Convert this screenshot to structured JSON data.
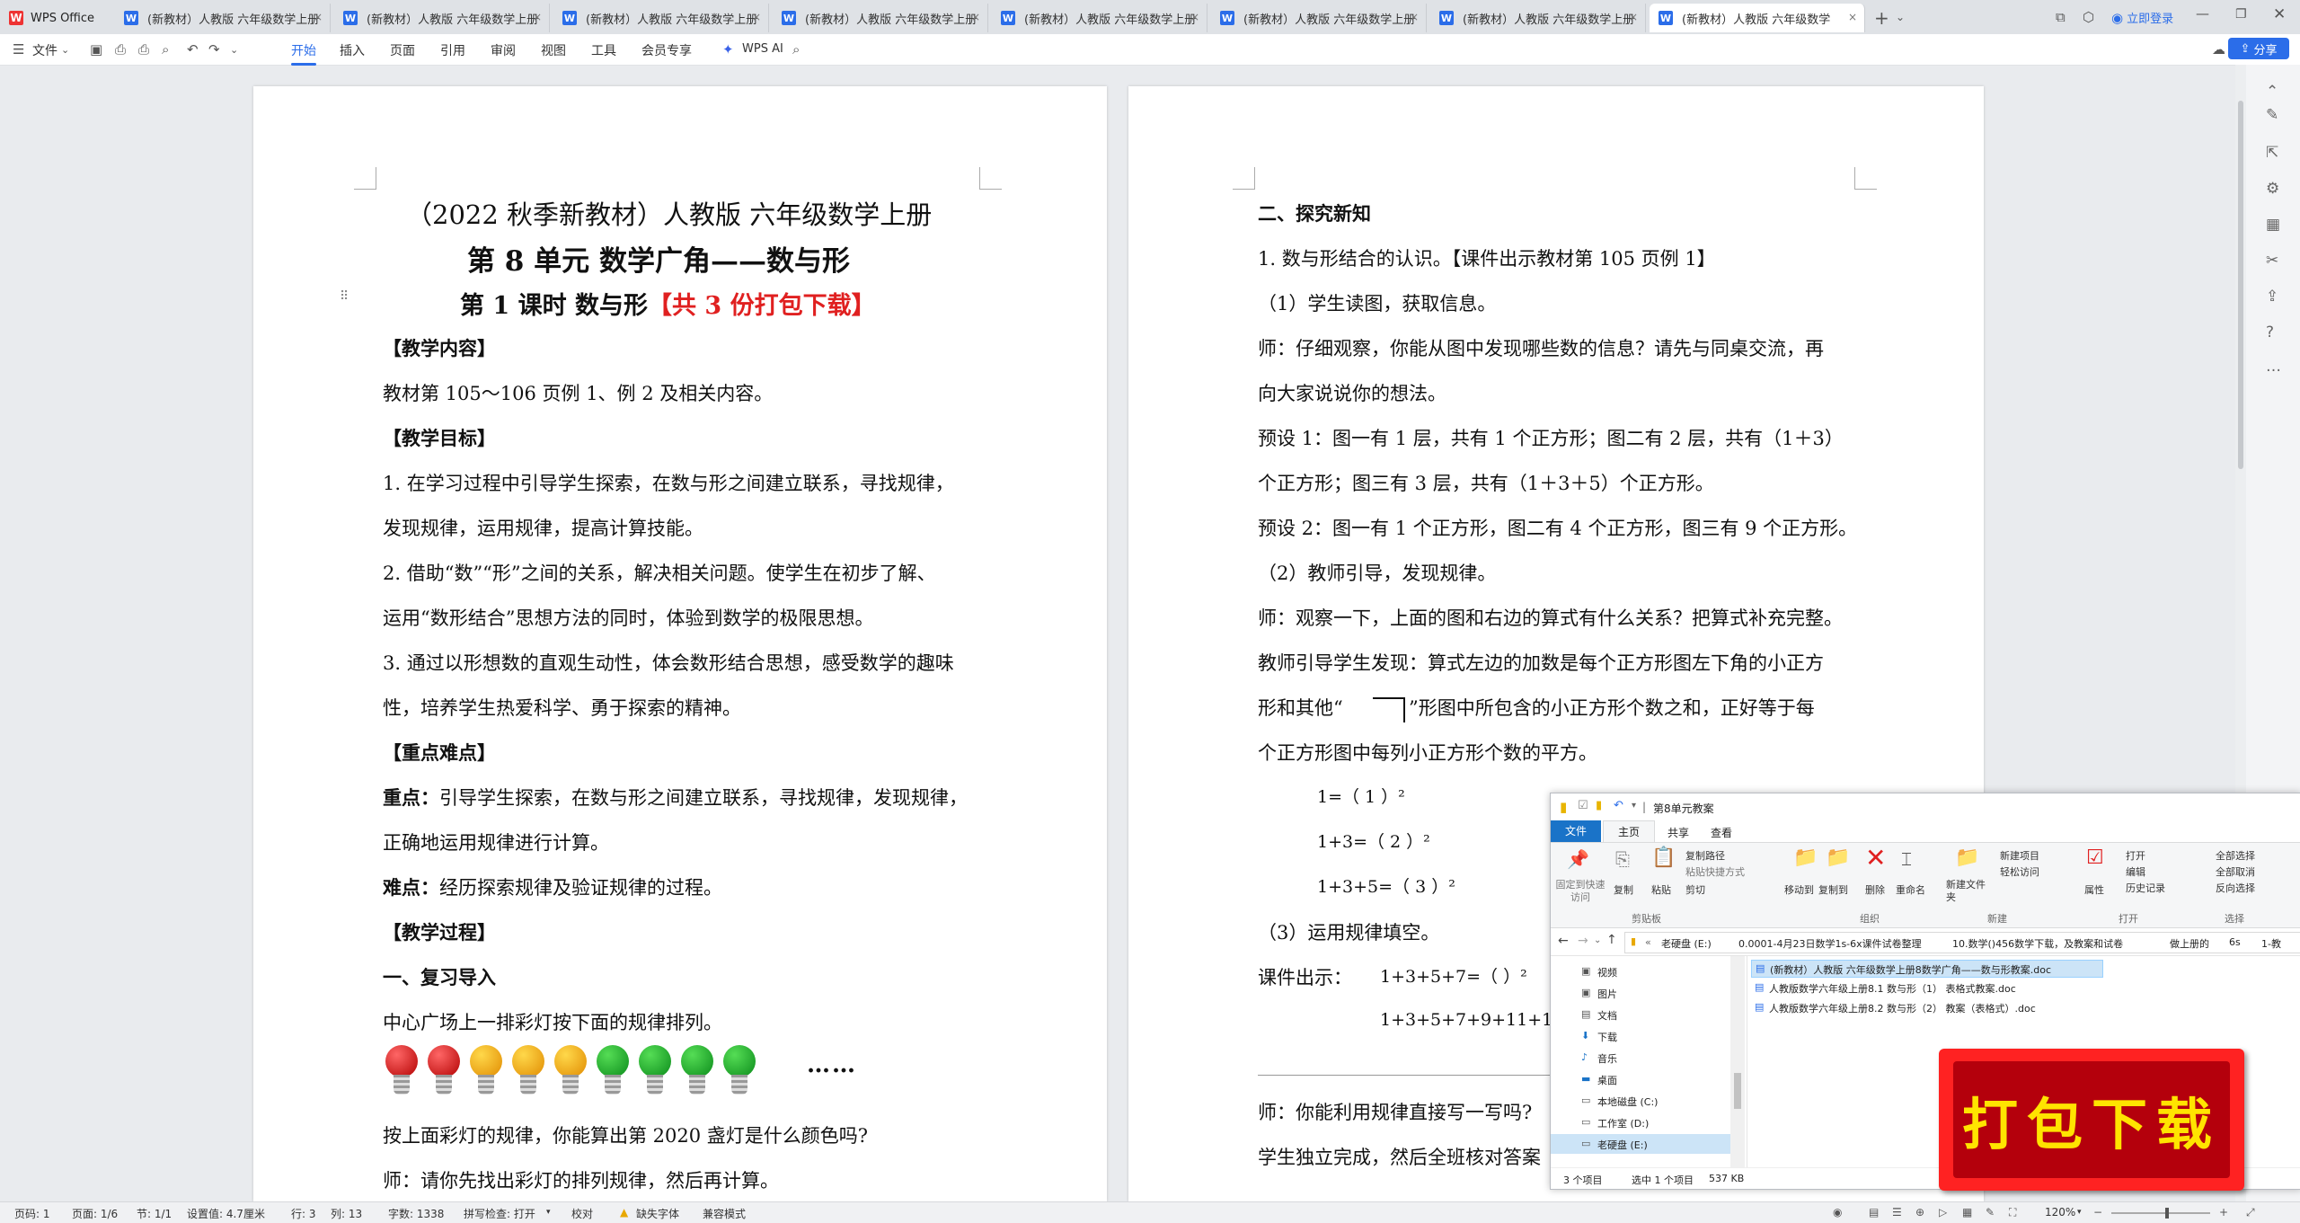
{
  "app": {
    "name": "WPS Office"
  },
  "tabs": [
    {
      "label": "(新教材）人教版 六年级数学上册"
    },
    {
      "label": "(新教材）人教版 六年级数学上册"
    },
    {
      "label": "(新教材）人教版 六年级数学上册"
    },
    {
      "label": "(新教材）人教版 六年级数学上册"
    },
    {
      "label": "(新教材）人教版 六年级数学上册"
    },
    {
      "label": "(新教材）人教版 六年级数学上册"
    },
    {
      "label": "(新教材）人教版 六年级数学上册"
    },
    {
      "label": "(新教材）人教版 六年级数学"
    }
  ],
  "titlebar": {
    "login": "立即登录",
    "share": "分享"
  },
  "toolbar": {
    "file": "文件",
    "menus": [
      "开始",
      "插入",
      "页面",
      "引用",
      "审阅",
      "视图",
      "工具",
      "会员专享"
    ],
    "wps_ai": "WPS AI"
  },
  "page1": {
    "title1": "（2022 秋季新教材）人教版  六年级数学上册",
    "title2": "第 8 单元  数学广角——数与形",
    "title3a": "第 1 课时    数与形",
    "title3b": "【共 3 份打包下载】",
    "lines": [
      "【教学内容】",
      "教材第 105～106 页例 1、例 2 及相关内容。",
      "【教学目标】",
      "1. 在学习过程中引导学生探索，在数与形之间建立联系，寻找规律，",
      "发现规律，运用规律，提高计算技能。",
      "2. 借助“数”“形”之间的关系，解决相关问题。使学生在初步了解、",
      "运用“数形结合”思想方法的同时，体验到数学的极限思想。",
      "3. 通过以形想数的直观生动性，体会数形结合思想，感受数学的趣味",
      "性，培养学生热爱科学、勇于探索的精神。",
      "【重点难点】",
      "正确地运用规律进行计算。",
      "【教学过程】",
      "一、复习导入",
      "中心广场上一排彩灯按下面的规律排列。",
      "按上面彩灯的规律，你能算出第 2020 盏灯是什么颜色吗?",
      "师：请你先找出彩灯的排列规律，然后再计算。"
    ],
    "zhongdian_label": "重点：",
    "zhongdian_text": "引导学生探索，在数与形之间建立联系，寻找规律，发现规律，",
    "nandian_label": "难点：",
    "nandian_text": "经历探索规律及验证规律的过程。",
    "dots": "……"
  },
  "page2": {
    "lines": [
      "二、探究新知",
      "1. 数与形结合的认识。【课件出示教材第 105 页例 1】",
      "（1）学生读图，获取信息。",
      "师：仔细观察，你能从图中发现哪些数的信息？请先与同桌交流，再",
      "向大家说说你的想法。",
      "预设 1：图一有 1 层，共有 1 个正方形；图二有 2 层，共有（1＋3）",
      "个正方形；图三有 3 层，共有（1＋3＋5）个正方形。",
      "预设 2：图一有 1 个正方形，图二有 4 个正方形，图三有 9 个正方形。",
      "（2）教师引导，发现规律。",
      "师：观察一下，上面的图和右边的算式有什么关系？把算式补充完整。",
      "教师引导学生发现：算式左边的加数是每个正方形图左下角的小正方",
      "形和其他“",
      "”形图中所包含的小正方形个数之和，正好等于每",
      "个正方形图中每列小正方形个数的平方。",
      "1=（ 1 ）²",
      "1+3=（ 2 ）²",
      "1+3+5=（ 3 ）²",
      "（3）运用规律填空。",
      "课件出示：",
      "1+3+5+7=（        ）²",
      "1+3+5+7+9+11+13=",
      "师：你能利用规律直接写一写吗?",
      "学生独立完成，然后全班核对答案"
    ]
  },
  "explorer": {
    "title": "第8单元教案",
    "ribbon_tabs": [
      "文件",
      "主页",
      "共享",
      "查看"
    ],
    "buttons": [
      "固定到快速访问",
      "复制",
      "粘贴",
      "复制路径",
      "粘贴快捷方式",
      "剪切",
      "移动到",
      "复制到",
      "删除",
      "重命名",
      "新建文件夹",
      "新建项目",
      "轻松访问",
      "属性",
      "打开",
      "编辑",
      "历史记录",
      "全部选择",
      "全部取消",
      "反向选择"
    ],
    "groups": [
      "剪贴板",
      "组织",
      "新建",
      "打开",
      "选择"
    ],
    "path": [
      "老硬盘 (E:)",
      "0.0001-4月23日数学1s-6x课件试卷整理",
      "10.数学()456数学下载，及教案和试卷",
      "做上册的",
      "6s",
      "1-教"
    ],
    "nav": [
      "视频",
      "图片",
      "文档",
      "下载",
      "音乐",
      "桌面",
      "本地磁盘 (C:)",
      "工作室 (D:)",
      "老硬盘 (E:)"
    ],
    "files": [
      "(新教材）人教版 六年级数学上册8数学广角——数与形教案.doc",
      "人教版数学六年级上册8.1 数与形（1） 表格式教案.doc",
      "人教版数学六年级上册8.2 数与形（2） 教案（表格式）.doc"
    ],
    "status": {
      "count": "3 个项目",
      "selected": "选中 1 个项目",
      "size": "537 KB"
    }
  },
  "promo": {
    "text": "打包下载"
  },
  "statusbar": {
    "page": "页码: 1",
    "pages": "页面: 1/6",
    "section": "节: 1/1",
    "setting": "设置值: 4.7厘米",
    "row": "行: 3",
    "col": "列: 13",
    "words": "字数: 1338",
    "spell": "拼写检查: 打开",
    "proof": "校对",
    "missing_font": "缺失字体",
    "compat": "兼容模式",
    "zoom": "120%"
  },
  "colors": {
    "accent": "#2b6de9",
    "red_text": "#e02020",
    "promo_bg": "#b4000c",
    "promo_text": "#ffe400"
  }
}
